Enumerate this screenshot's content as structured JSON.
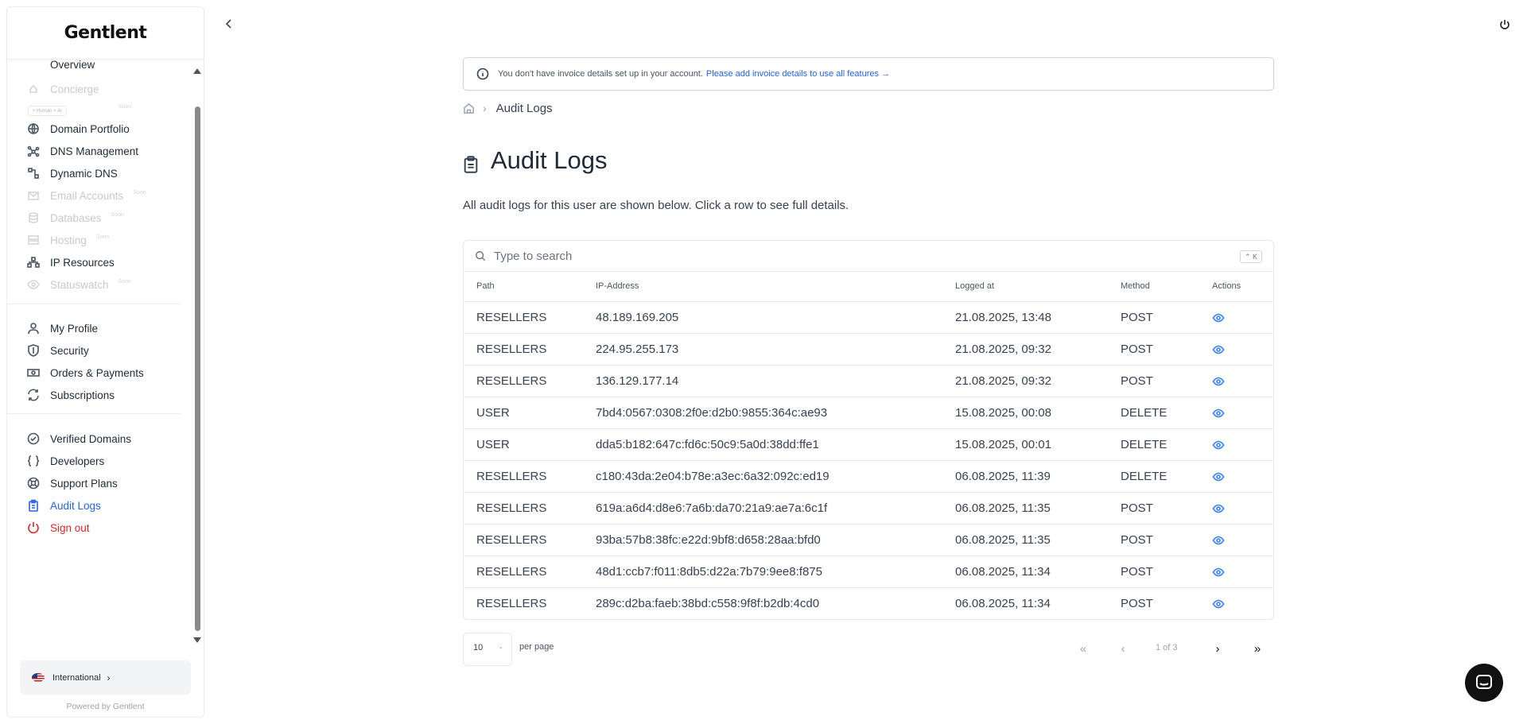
{
  "brand": {
    "logo_text": "Gentlent",
    "powered_by": "Powered by Gentlent"
  },
  "sidebar": {
    "cut_item": "Overview",
    "concierge": {
      "label": "Concierge",
      "badge": "+ Human + AI",
      "soon": "Soon"
    },
    "items": [
      {
        "label": "Domain Portfolio",
        "soon": ""
      },
      {
        "label": "DNS Management",
        "soon": ""
      },
      {
        "label": "Dynamic DNS",
        "soon": ""
      },
      {
        "label": "Email Accounts",
        "soon": "Soon"
      },
      {
        "label": "Databases",
        "soon": "Soon"
      },
      {
        "label": "Hosting",
        "soon": "Soon"
      },
      {
        "label": "IP Resources",
        "soon": ""
      },
      {
        "label": "Statuswatch",
        "soon": "Soon"
      }
    ],
    "account": [
      {
        "label": "My Profile"
      },
      {
        "label": "Security"
      },
      {
        "label": "Orders & Payments"
      },
      {
        "label": "Subscriptions"
      }
    ],
    "other": [
      {
        "label": "Verified Domains"
      },
      {
        "label": "Developers"
      },
      {
        "label": "Support Plans"
      },
      {
        "label": "Audit Logs"
      },
      {
        "label": "Sign out"
      }
    ],
    "language": "International"
  },
  "notice": {
    "text": "You don't have invoice details set up in your account.",
    "link": "Please add invoice details to use all features →"
  },
  "breadcrumb": {
    "current": "Audit Logs"
  },
  "page": {
    "title": "Audit Logs",
    "description": "All audit logs for this user are shown below. Click a row to see full details."
  },
  "search": {
    "placeholder": "Type to search",
    "shortcut": "⌃ K"
  },
  "table": {
    "headers": {
      "path": "Path",
      "ip": "IP-Address",
      "logged": "Logged at",
      "method": "Method",
      "actions": "Actions"
    },
    "rows": [
      {
        "path": "RESELLERS",
        "ip": "48.189.169.205",
        "logged": "21.08.2025, 13:48",
        "method": "POST"
      },
      {
        "path": "RESELLERS",
        "ip": "224.95.255.173",
        "logged": "21.08.2025, 09:32",
        "method": "POST"
      },
      {
        "path": "RESELLERS",
        "ip": "136.129.177.14",
        "logged": "21.08.2025, 09:32",
        "method": "POST"
      },
      {
        "path": "USER",
        "ip": "7bd4:0567:0308:2f0e:d2b0:9855:364c:ae93",
        "logged": "15.08.2025, 00:08",
        "method": "DELETE"
      },
      {
        "path": "USER",
        "ip": "dda5:b182:647c:fd6c:50c9:5a0d:38dd:ffe1",
        "logged": "15.08.2025, 00:01",
        "method": "DELETE"
      },
      {
        "path": "RESELLERS",
        "ip": "c180:43da:2e04:b78e:a3ec:6a32:092c:ed19",
        "logged": "06.08.2025, 11:39",
        "method": "DELETE"
      },
      {
        "path": "RESELLERS",
        "ip": "619a:a6d4:d8e6:7a6b:da70:21a9:ae7a:6c1f",
        "logged": "06.08.2025, 11:35",
        "method": "POST"
      },
      {
        "path": "RESELLERS",
        "ip": "93ba:57b8:38fc:e22d:9bf8:d658:28aa:bfd0",
        "logged": "06.08.2025, 11:35",
        "method": "POST"
      },
      {
        "path": "RESELLERS",
        "ip": "48d1:ccb7:f011:8db5:d22a:7b79:9ee8:f875",
        "logged": "06.08.2025, 11:34",
        "method": "POST"
      },
      {
        "path": "RESELLERS",
        "ip": "289c:d2ba:faeb:38bd:c558:9f8f:b2db:4cd0",
        "logged": "06.08.2025, 11:34",
        "method": "POST"
      }
    ]
  },
  "pagination": {
    "per_page_value": "10",
    "per_page_label": "per page",
    "info": "1 of 3"
  },
  "colors": {
    "accent": "#2563eb",
    "danger": "#dc2626",
    "eye": "#3b82f6"
  }
}
